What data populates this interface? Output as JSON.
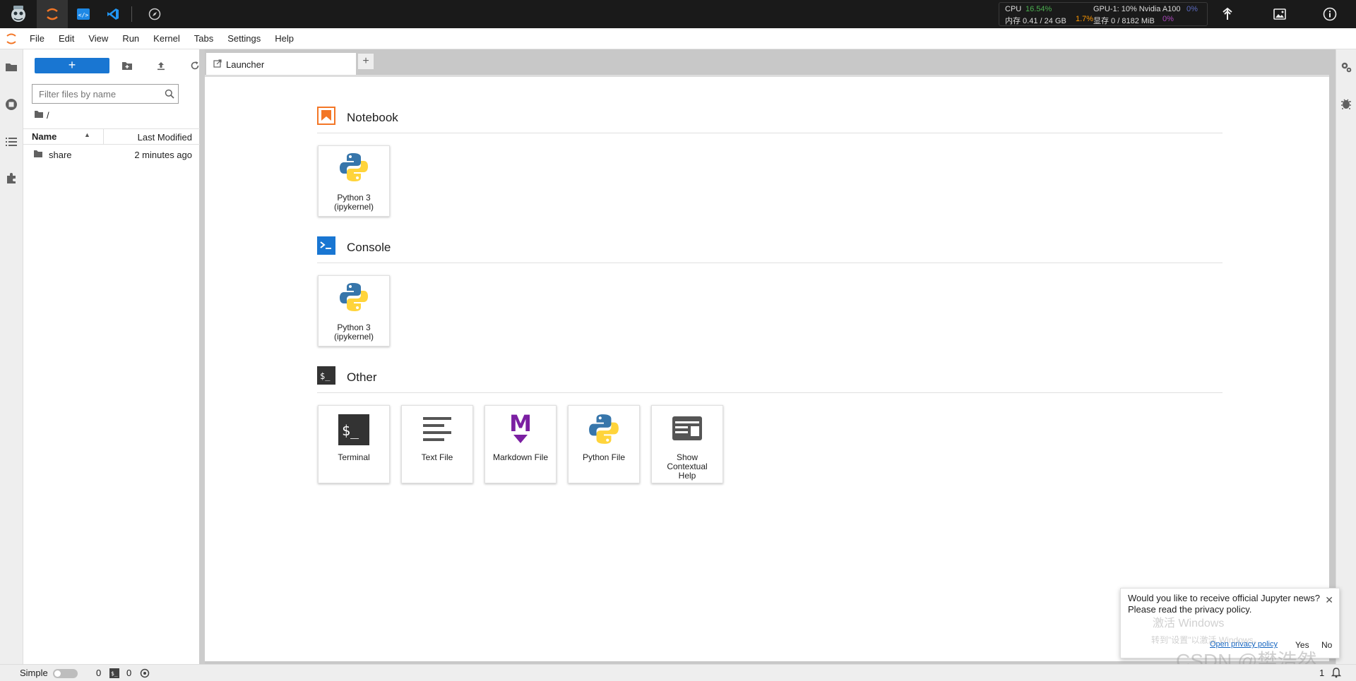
{
  "topbar": {
    "metrics": {
      "cpu_label": "CPU",
      "cpu_value": "16.54%",
      "mem_label": "内存 0.41 / 24 GB",
      "mem_value": "1.7%",
      "gpu_label": "GPU-1: 10% Nvidia A100",
      "gpu_value": "0%",
      "vram_label": "显存 0 / 8182 MiB",
      "vram_value": "0%"
    },
    "colors": {
      "cpu": "#4caf50",
      "mem": "#ff9800",
      "gpu": "#3f51b5",
      "vram": "#9c27b0"
    }
  },
  "menu": [
    "File",
    "Edit",
    "View",
    "Run",
    "Kernel",
    "Tabs",
    "Settings",
    "Help"
  ],
  "filebrowser": {
    "new_label": "+",
    "filter_placeholder": "Filter files by name",
    "breadcrumb": "/",
    "col_name": "Name",
    "col_modified": "Last Modified",
    "rows": [
      {
        "name": "share",
        "modified": "2 minutes ago"
      }
    ]
  },
  "tab": {
    "label": "Launcher",
    "add_label": "+"
  },
  "launcher": {
    "sections": [
      {
        "title": "Notebook",
        "cards": [
          {
            "label": "Python 3\n(ipykernel)",
            "icon": "python-logo"
          }
        ]
      },
      {
        "title": "Console",
        "cards": [
          {
            "label": "Python 3\n(ipykernel)",
            "icon": "python-logo"
          }
        ]
      },
      {
        "title": "Other",
        "cards": [
          {
            "label": "Terminal",
            "icon": "terminal-icon"
          },
          {
            "label": "Text File",
            "icon": "text-file-icon"
          },
          {
            "label": "Markdown File",
            "icon": "markdown-icon"
          },
          {
            "label": "Python File",
            "icon": "python-logo"
          },
          {
            "label": "Show\nContextual\nHelp",
            "icon": "contextual-help-icon"
          }
        ]
      }
    ]
  },
  "toast": {
    "message_line1": "Would you like to receive official Jupyter news?",
    "message_line2": "Please read the privacy policy.",
    "link": "Open privacy policy",
    "yes": "Yes",
    "no": "No"
  },
  "statusbar": {
    "mode": "Simple",
    "kernels": "0",
    "terminals": "0"
  },
  "watermarks": {
    "windows_line1": "激活 Windows",
    "windows_line2": "转到\"设置\"以激活 Windows。",
    "csdn": "CSDN @樊浩然",
    "corner_count": "1"
  }
}
